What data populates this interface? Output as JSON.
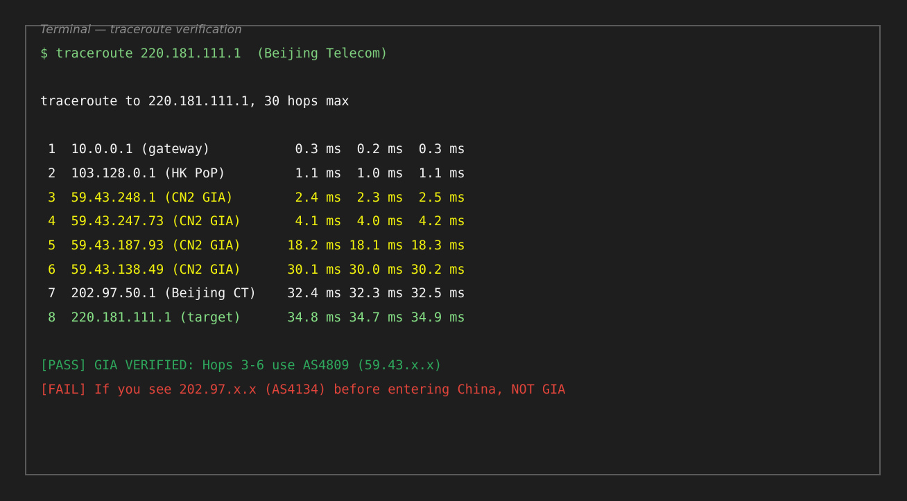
{
  "window": {
    "title": "Terminal — traceroute verification"
  },
  "terminal": {
    "command": "$ traceroute 220.181.111.1  (Beijing Telecom)",
    "header": "traceroute to 220.181.111.1, 30 hops max",
    "hops": [
      {
        "text": " 1  10.0.0.1 (gateway)           0.3 ms  0.2 ms  0.3 ms",
        "color": "#f2f2f2"
      },
      {
        "text": " 2  103.128.0.1 (HK PoP)         1.1 ms  1.0 ms  1.1 ms",
        "color": "#f2f2f2"
      },
      {
        "text": " 3  59.43.248.1 (CN2 GIA)        2.4 ms  2.3 ms  2.5 ms",
        "color": "#f1f10e"
      },
      {
        "text": " 4  59.43.247.73 (CN2 GIA)       4.1 ms  4.0 ms  4.2 ms",
        "color": "#f1f10e"
      },
      {
        "text": " 5  59.43.187.93 (CN2 GIA)      18.2 ms 18.1 ms 18.3 ms",
        "color": "#f1f10e"
      },
      {
        "text": " 6  59.43.138.49 (CN2 GIA)      30.1 ms 30.0 ms 30.2 ms",
        "color": "#f1f10e"
      },
      {
        "text": " 7  202.97.50.1 (Beijing CT)    32.4 ms 32.3 ms 32.5 ms",
        "color": "#f2f2f2"
      },
      {
        "text": " 8  220.181.111.1 (target)      34.8 ms 34.7 ms 34.9 ms",
        "color": "#86e086"
      }
    ],
    "pass_message": "[PASS] GIA VERIFIED: Hops 3-6 use AS4809 (59.43.x.x)",
    "fail_message": "[FAIL] If you see 202.97.x.x (AS4134) before entering China, NOT GIA"
  }
}
